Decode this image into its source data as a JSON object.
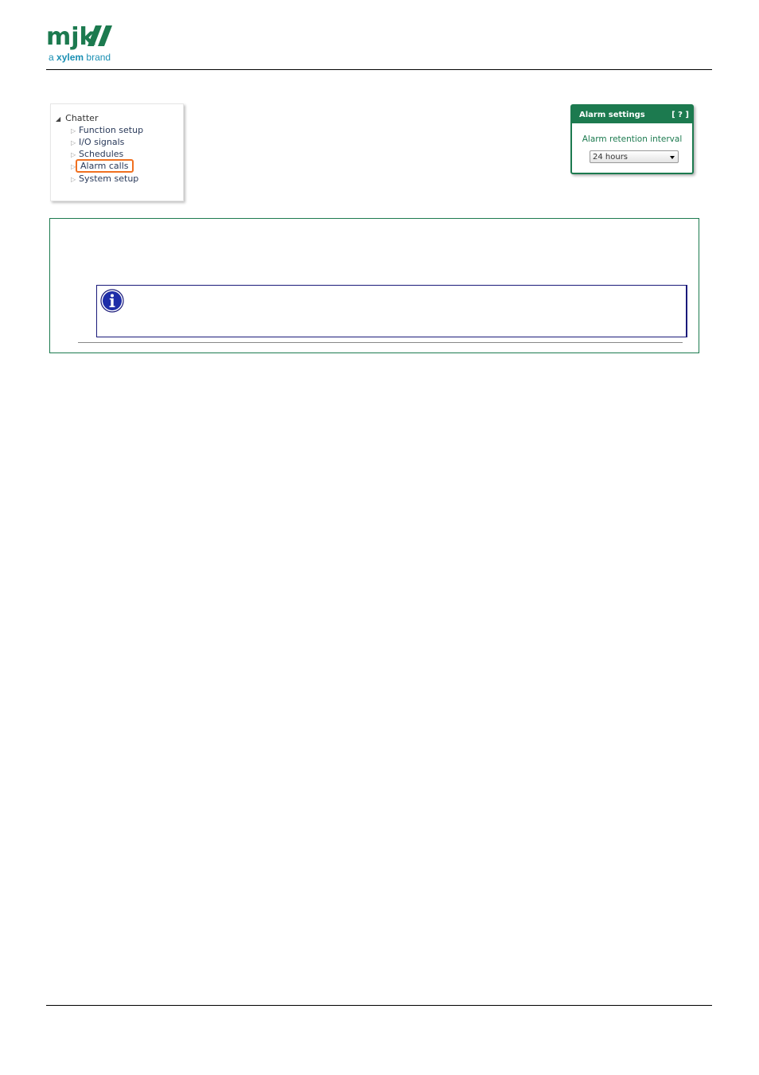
{
  "brand": {
    "logo_text": "mjk",
    "tagline_prefix": "a",
    "tagline_brand": "xylem",
    "tagline_suffix": "brand",
    "primary_color": "#1c7a4f",
    "secondary_color": "#1a8fb3"
  },
  "tree": {
    "root_label": "Chatter",
    "root_icon": "expanded-triangle-icon",
    "items": [
      {
        "label": "Function setup",
        "selected": false
      },
      {
        "label": "I/O signals",
        "selected": false
      },
      {
        "label": "Schedules",
        "selected": false
      },
      {
        "label": "Alarm calls",
        "selected": true
      },
      {
        "label": "System setup",
        "selected": false
      }
    ],
    "highlight_color": "#f07020"
  },
  "alarm_settings": {
    "title": "Alarm settings",
    "help_label": "[ ? ]",
    "field_label": "Alarm retention interval",
    "selected_value": "24 hours"
  },
  "note": {
    "icon": "info-icon"
  }
}
